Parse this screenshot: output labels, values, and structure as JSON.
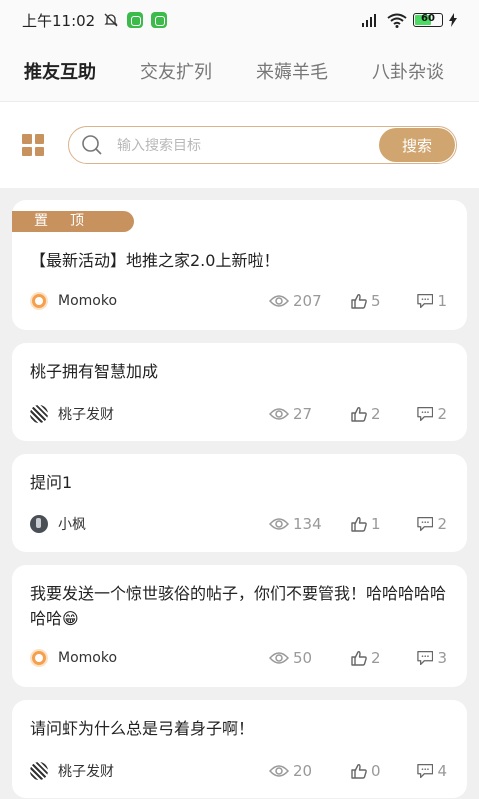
{
  "status": {
    "time": "上午11:02",
    "battery": "60"
  },
  "tabs": [
    "推友互助",
    "交友扩列",
    "来薅羊毛",
    "八卦杂谈"
  ],
  "search": {
    "placeholder": "输入搜索目标",
    "button": "搜索"
  },
  "pin_label": "置顶",
  "posts": [
    {
      "pinned": true,
      "title": "【最新活动】地推之家2.0上新啦！",
      "author": "Momoko",
      "avatar": "momoko",
      "views": "207",
      "likes": "5",
      "comments": "1"
    },
    {
      "title": "桃子拥有智慧加成",
      "author": "桃子发财",
      "avatar": "peach",
      "views": "27",
      "likes": "2",
      "comments": "2"
    },
    {
      "title": "提问1",
      "author": "小枫",
      "avatar": "feng",
      "views": "134",
      "likes": "1",
      "comments": "2"
    },
    {
      "title": "我要发送一个惊世骇俗的帖子，你们不要管我！哈哈哈哈哈哈哈😁",
      "author": "Momoko",
      "avatar": "momoko",
      "views": "50",
      "likes": "2",
      "comments": "3"
    },
    {
      "title": "请问虾为什么总是弓着身子啊！",
      "author": "桃子发财",
      "avatar": "peach",
      "views": "20",
      "likes": "0",
      "comments": "4"
    }
  ],
  "colors": {
    "accent": "#c8925e",
    "button": "#d1a570"
  }
}
